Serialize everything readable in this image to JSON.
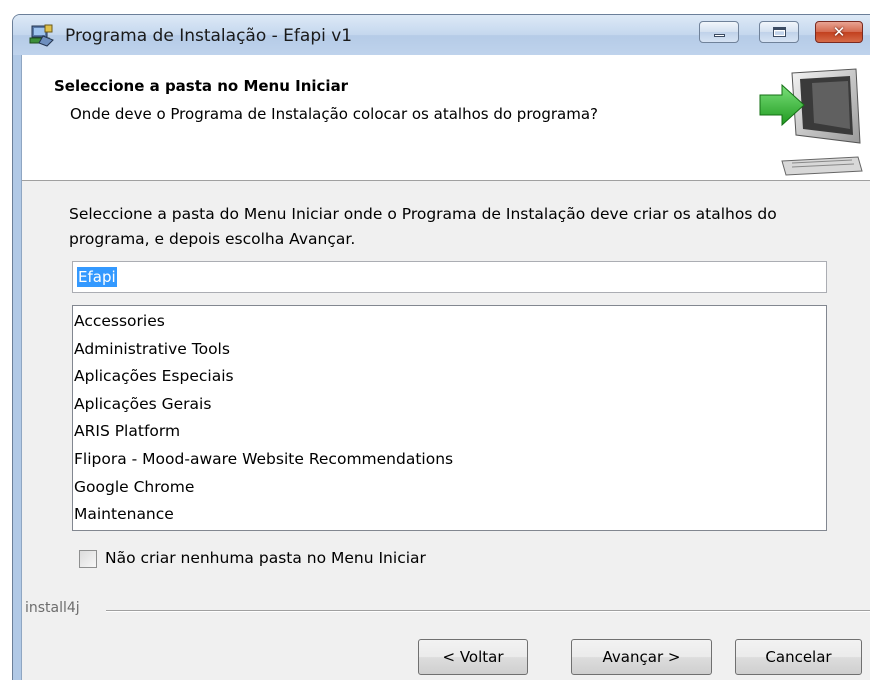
{
  "window": {
    "title": "Programa de Instalação - Efapi v1",
    "controls": [
      "minimize",
      "maximize",
      "close"
    ]
  },
  "header": {
    "title": "Seleccione a pasta no Menu Iniciar",
    "subtitle": "Onde deve o Programa de Instalação colocar os atalhos do programa?"
  },
  "body": {
    "instructions": "Seleccione a pasta do Menu Iniciar onde o Programa de Instalação deve criar os atalhos do programa, e depois escolha Avançar.",
    "folder_name_value": "Efapi",
    "folders": [
      "Accessories",
      "Administrative Tools",
      "Aplicações Especiais",
      "Aplicações Gerais",
      "ARIS Platform",
      "Flipora - Mood-aware Website Recommendations",
      "Google Chrome",
      "Maintenance"
    ],
    "no_folder_checkbox": {
      "label": "Não criar nenhuma pasta no Menu Iniciar",
      "checked": false
    }
  },
  "footer": {
    "brand": "install4j",
    "back_label": "< Voltar",
    "next_label": "Avançar >",
    "cancel_label": "Cancelar"
  },
  "colors": {
    "selection": "#3399ff",
    "arrow": "#2fb52f",
    "titlebar": "#c4d7ee",
    "close_button": "#c9472a"
  }
}
